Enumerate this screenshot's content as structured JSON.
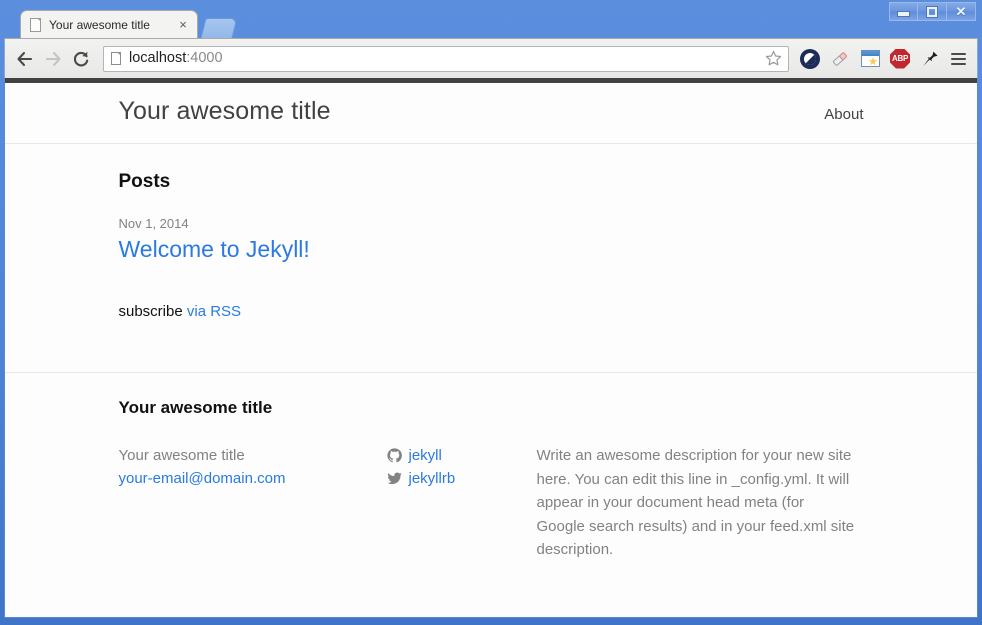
{
  "browser": {
    "window_controls": {
      "minimize_label": "Minimize",
      "maximize_label": "Maximize",
      "close_label": "Close"
    },
    "tab": {
      "title": "Your awesome title",
      "close_label": "×",
      "new_tab_label": "New Tab"
    },
    "nav": {
      "back_label": "Back",
      "forward_label": "Forward",
      "reload_label": "Reload"
    },
    "omnibox": {
      "host": "localhost",
      "port": ":4000",
      "bookmark_label": "Bookmark this page"
    },
    "extensions": [
      {
        "name": "opera-extension-icon",
        "label": "Opera"
      },
      {
        "name": "eraser-extension-icon",
        "label": "Eraser"
      },
      {
        "name": "note-extension-icon",
        "label": "Notes"
      },
      {
        "name": "adblock-plus-icon",
        "label": "ABP"
      },
      {
        "name": "pin-extension-icon",
        "label": "Pin"
      }
    ],
    "menu_label": "Customize and control"
  },
  "site": {
    "header": {
      "title": "Your awesome title",
      "nav": [
        {
          "label": "About"
        }
      ]
    },
    "content": {
      "posts_heading": "Posts",
      "posts": [
        {
          "date": "Nov 1, 2014",
          "title": "Welcome to Jekyll!"
        }
      ],
      "subscribe_prefix": "subscribe ",
      "subscribe_link": "via RSS"
    },
    "footer": {
      "heading": "Your awesome title",
      "contact": {
        "name": "Your awesome title",
        "email": "your-email@domain.com"
      },
      "social": [
        {
          "icon": "github-icon",
          "label": "jekyll"
        },
        {
          "icon": "twitter-icon",
          "label": "jekyllrb"
        }
      ],
      "description": "Write an awesome description for your new site here. You can edit this line in _config.yml. It will appear in your document head meta (for Google search results) and in your feed.xml site description."
    }
  },
  "colors": {
    "link": "#2a7ae2",
    "muted": "#828282",
    "text": "#111111",
    "brand_bar": "#424242",
    "chrome_blue": "#5083d6"
  }
}
